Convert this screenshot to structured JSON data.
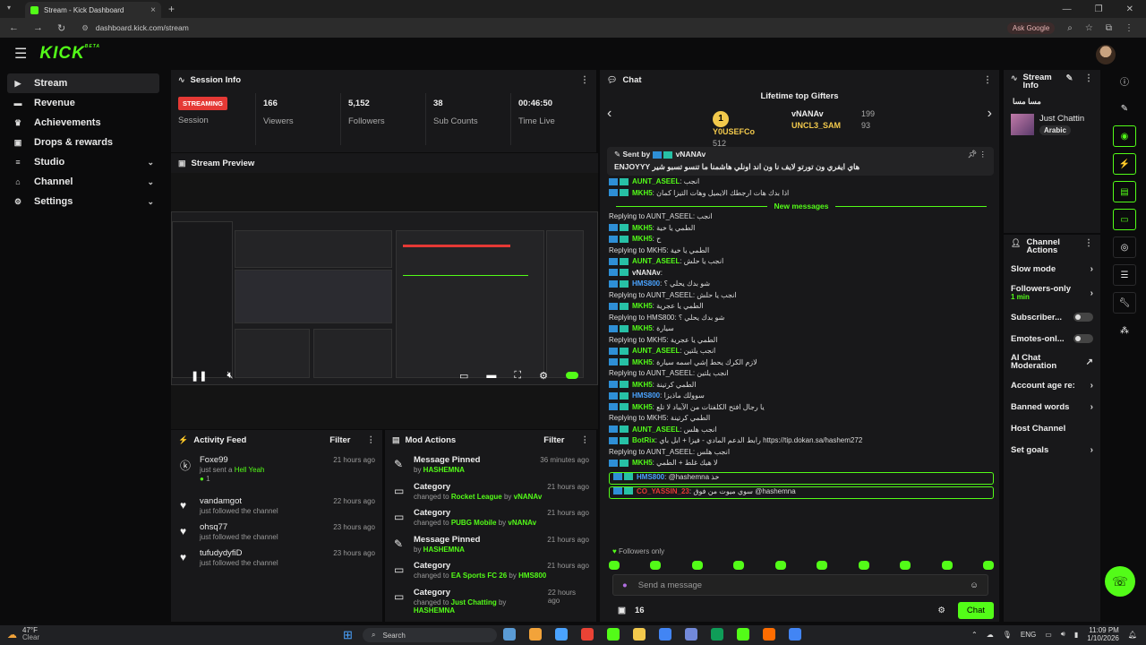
{
  "browser": {
    "tab_title": "Stream - Kick Dashboard",
    "url": "dashboard.kick.com/stream",
    "ask_google": "Ask Google"
  },
  "app": {
    "logo": "KICK",
    "logo_sup": "BETA"
  },
  "sidebar": {
    "items": [
      {
        "label": "Stream",
        "icon": "broadcast-icon"
      },
      {
        "label": "Revenue",
        "icon": "wallet-icon"
      },
      {
        "label": "Achievements",
        "icon": "trophy-icon"
      },
      {
        "label": "Drops & rewards",
        "icon": "gift-icon"
      },
      {
        "label": "Studio",
        "icon": "sliders-icon"
      },
      {
        "label": "Channel",
        "icon": "channel-icon"
      },
      {
        "label": "Settings",
        "icon": "gear-icon"
      }
    ]
  },
  "session": {
    "title": "Session Info",
    "status": "STREAMING",
    "status_label": "Session",
    "stats": [
      {
        "value": "166",
        "label": "Viewers"
      },
      {
        "value": "5,152",
        "label": "Followers"
      },
      {
        "value": "38",
        "label": "Sub Counts"
      },
      {
        "value": "00:46:50",
        "label": "Time Live"
      }
    ]
  },
  "preview": {
    "title": "Stream Preview"
  },
  "feed": {
    "title": "Activity Feed",
    "filter": "Filter",
    "items": [
      {
        "name": "Foxe99",
        "sub_pre": "just sent a ",
        "sub_hl": "Hell Yeah",
        "extra": "1",
        "time": "21 hours ago"
      },
      {
        "name": "vandamgot",
        "sub_pre": "just followed the channel",
        "sub_hl": "",
        "extra": "",
        "time": "22 hours ago"
      },
      {
        "name": "ohsq77",
        "sub_pre": "just followed the channel",
        "sub_hl": "",
        "extra": "",
        "time": "23 hours ago"
      },
      {
        "name": "tufudydyfiD",
        "sub_pre": "just followed the channel",
        "sub_hl": "",
        "extra": "",
        "time": "23 hours ago"
      }
    ]
  },
  "mod": {
    "title": "Mod Actions",
    "filter": "Filter",
    "items": [
      {
        "title": "Message Pinned",
        "pre": "by ",
        "target": "HASHEMNA",
        "by": "",
        "time": "36 minutes ago"
      },
      {
        "title": "Category",
        "pre": "changed to ",
        "target": "Rocket League",
        "by": "vNANAv",
        "time": "21 hours ago"
      },
      {
        "title": "Category",
        "pre": "changed to ",
        "target": "PUBG Mobile",
        "by": "vNANAv",
        "time": "21 hours ago"
      },
      {
        "title": "Message Pinned",
        "pre": "by ",
        "target": "HASHEMNA",
        "by": "",
        "time": "21 hours ago"
      },
      {
        "title": "Category",
        "pre": "changed to ",
        "target": "EA Sports FC 26",
        "by": "HMS800",
        "time": "21 hours ago"
      },
      {
        "title": "Category",
        "pre": "changed to ",
        "target": "Just Chatting",
        "by": "HASHEMNA",
        "time": "22 hours ago"
      }
    ]
  },
  "chat": {
    "title": "Chat",
    "gifters_title": "Lifetime top Gifters",
    "gifters": [
      {
        "name": "Y0USEFCo",
        "count": "512"
      },
      {
        "name": "vNANAv",
        "count": "199"
      },
      {
        "name": "UNCL3_SAM",
        "count": "93"
      }
    ],
    "pinned": {
      "sent_by": "Sent by",
      "user": "vNANAv",
      "text": "هاي ايفري ون تورتو لايف نا ون اند اونلي هاشمنا ما تنسو تسبو شير ENJOYYY"
    },
    "new_messages": "New messages",
    "messages": [
      {
        "reply": "",
        "user": "AUNT_ASEEL",
        "color": "#53fc18",
        "text": "انجب",
        "hl": false
      },
      {
        "reply": "",
        "user": "MKH5",
        "color": "#53fc18",
        "text": "اذا بدك هات ارجطك الايميل وهات التيزا كمان",
        "hl": false
      },
      {
        "reply": "Replying to AUNT_ASEEL: انجب",
        "user": "MKH5",
        "color": "#53fc18",
        "text": "الطمي يا خية",
        "hl": false
      },
      {
        "reply": "",
        "user": "MKH5",
        "color": "#53fc18",
        "text": "ح",
        "hl": false
      },
      {
        "reply": "Replying to MKH5: الطمي يا خية",
        "user": "AUNT_ASEEL",
        "color": "#53fc18",
        "text": "انجب يا حلش",
        "hl": false
      },
      {
        "reply": "",
        "user": "vNANAv",
        "color": "#e8e8e8",
        "text": "",
        "hl": false
      },
      {
        "reply": "",
        "user": "HMS800",
        "color": "#4aa3ff",
        "text": "شو بدك يحلي ؟",
        "hl": false
      },
      {
        "reply": "Replying to AUNT_ASEEL: انجب يا حلش",
        "user": "MKH5",
        "color": "#53fc18",
        "text": "الطمي يا عجرية",
        "hl": false
      },
      {
        "reply": "Replying to HMS800: شو بدك يحلي ؟",
        "user": "MKH5",
        "color": "#53fc18",
        "text": "سيارة",
        "hl": false
      },
      {
        "reply": "Replying to MKH5: الطمي يا عجرية",
        "user": "AUNT_ASEEL",
        "color": "#53fc18",
        "text": "انجب يلتين",
        "hl": false
      },
      {
        "reply": "",
        "user": "MKH5",
        "color": "#53fc18",
        "text": "لازم الكرك يحط إشي اسمه سيارة",
        "hl": false
      },
      {
        "reply": "Replying to AUNT_ASEEL: انجب يلتين",
        "user": "MKH5",
        "color": "#53fc18",
        "text": "الطمي كرتينة",
        "hl": false
      },
      {
        "reply": "",
        "user": "HMS800",
        "color": "#4aa3ff",
        "text": "سوولك ماذيزا",
        "hl": false
      },
      {
        "reply": "",
        "user": "MKH5",
        "color": "#53fc18",
        "text": "يا رجال افتح الكلفتات من الآيباد لا تلع",
        "hl": false
      },
      {
        "reply": "Replying to MKH5: الطمي كرتينة",
        "user": "AUNT_ASEEL",
        "color": "#53fc18",
        "text": "انجب هلس",
        "hl": false
      },
      {
        "reply": "",
        "user": "BotRix",
        "color": "#53fc18",
        "text": "رابط الدعم المادي - فيزا + ابل باي https://tip.dokan.sa/hashem272",
        "hl": false
      },
      {
        "reply": "Replying to AUNT_ASEEL: انجب هلس",
        "user": "MKH5",
        "color": "#53fc18",
        "text": "لا هيك غلط + الطمي",
        "hl": false
      },
      {
        "reply": "",
        "user": "HMS800",
        "color": "#4aa3ff",
        "text": "@hashemna خذ",
        "hl": true
      },
      {
        "reply": "",
        "user": "CO_YASSIN_23",
        "color": "#e53935",
        "text": "سوي ميوت من فوق @hashemna",
        "hl": true
      }
    ],
    "followers_only": "Followers only",
    "input_placeholder": "Send a message",
    "count": "16",
    "send_label": "Chat"
  },
  "stream_info": {
    "title": "Stream Info",
    "stream_title": "مسا مسا",
    "category": "Just Chattin",
    "tag": "Arabic"
  },
  "channel_actions": {
    "title": "Channel Actions",
    "items": [
      {
        "label": "Slow mode",
        "type": "chevron",
        "sub": ""
      },
      {
        "label": "Followers-only",
        "type": "chevron",
        "sub": "1 min"
      },
      {
        "label": "Subscriber...",
        "type": "switch",
        "sub": ""
      },
      {
        "label": "Emotes-onl...",
        "type": "switch",
        "sub": ""
      },
      {
        "label": "AI Chat Moderation",
        "type": "external",
        "sub": ""
      },
      {
        "label": "Account age re:",
        "type": "chevron",
        "sub": ""
      },
      {
        "label": "Banned words",
        "type": "chevron",
        "sub": ""
      },
      {
        "label": "Host Channel",
        "type": "none",
        "sub": ""
      },
      {
        "label": "Set goals",
        "type": "chevron",
        "sub": ""
      }
    ]
  },
  "taskbar": {
    "weather_temp": "47°F",
    "weather_text": "Clear",
    "search": "Search",
    "lang": "ENG",
    "time": "11:09 PM",
    "date": "1/10/2026"
  }
}
